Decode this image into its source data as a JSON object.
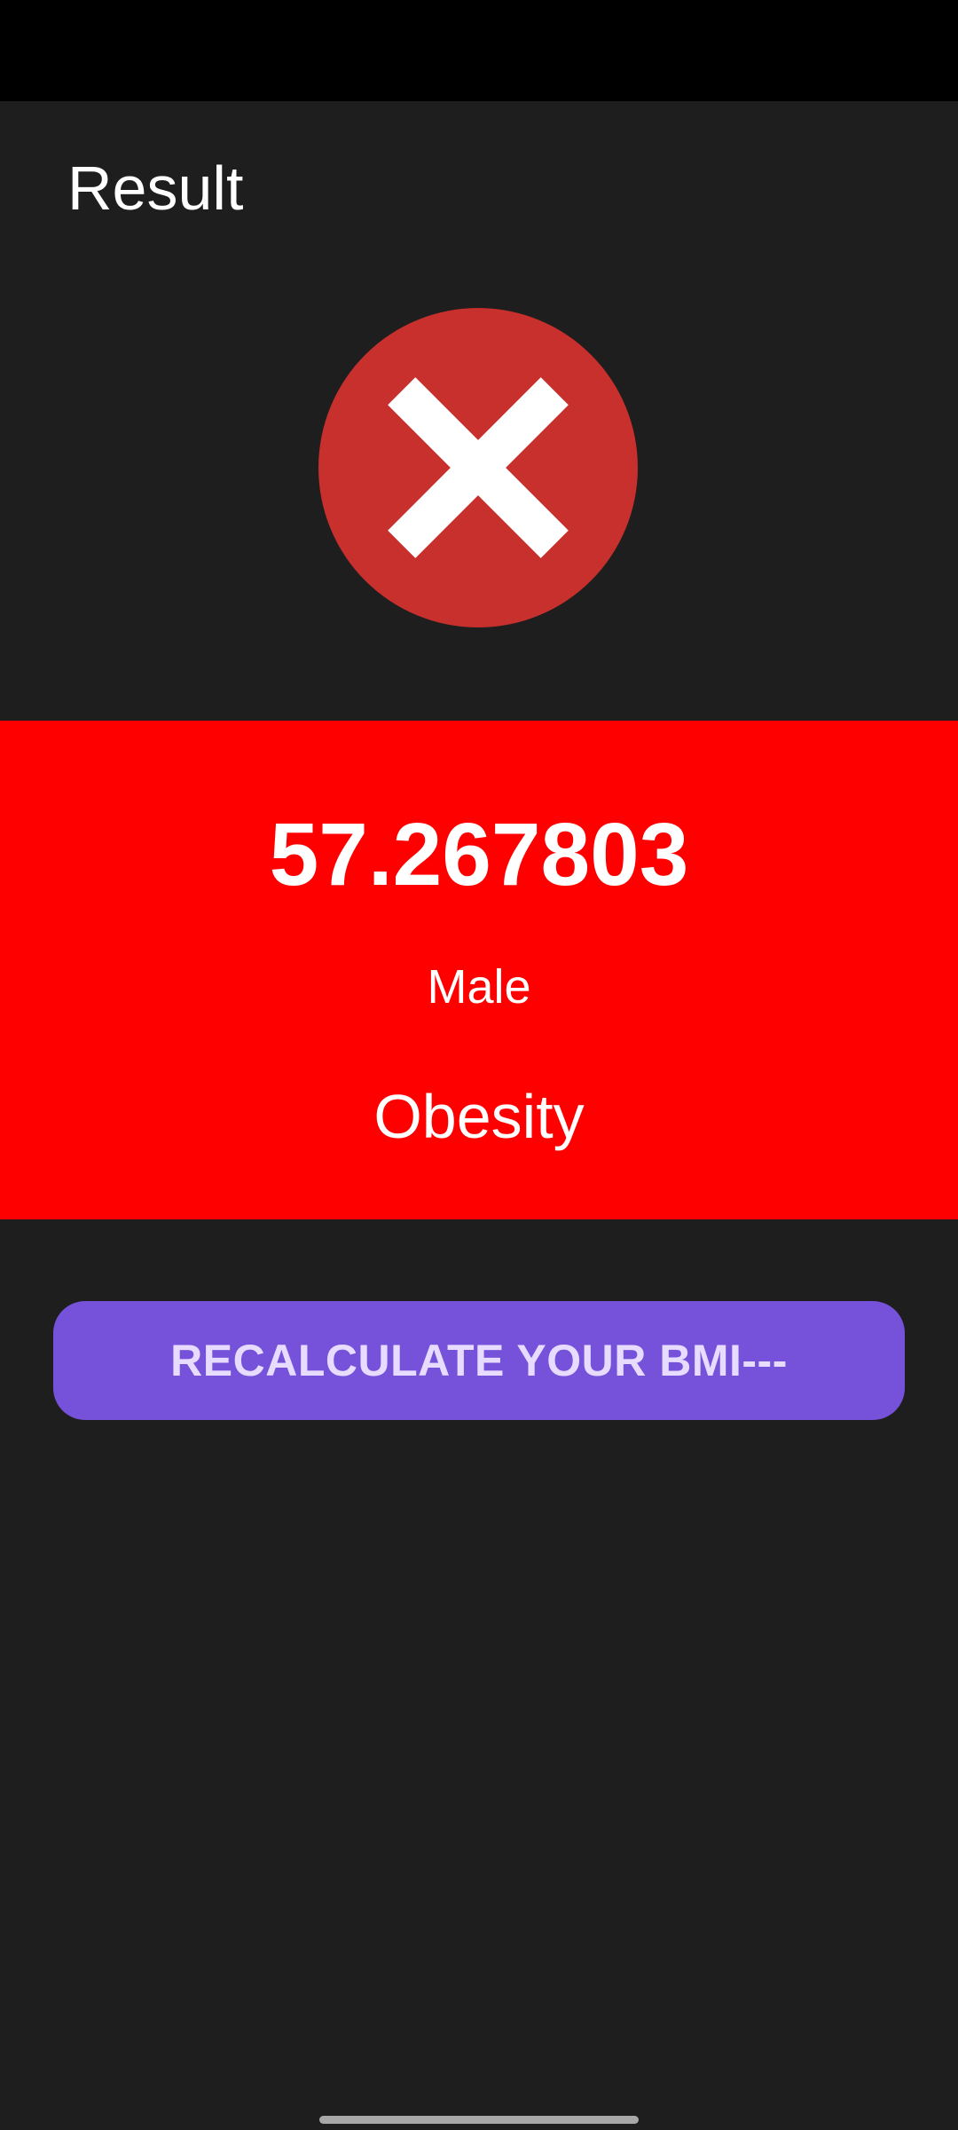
{
  "header": {
    "title": "Result"
  },
  "status_icon": {
    "name": "error-x-icon",
    "circle_color": "#c8302d",
    "mark_color": "#ffffff"
  },
  "result": {
    "bmi": "57.267803",
    "gender": "Male",
    "category": "Obesity",
    "panel_color": "#ff0000"
  },
  "actions": {
    "recalculate_label": "RECALCULATE YOUR BMI---",
    "button_color": "#7552d9"
  },
  "colors": {
    "background": "#1e1e1e",
    "status_bar": "#000000"
  }
}
